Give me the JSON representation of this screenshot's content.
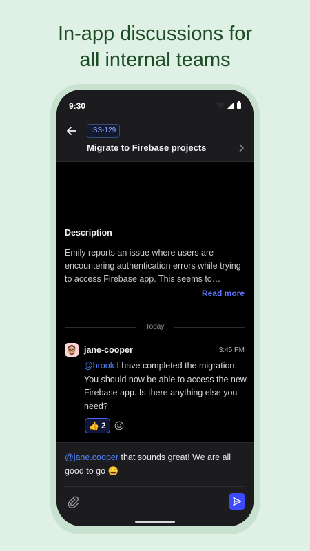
{
  "headline": {
    "line1": "In-app discussions for",
    "line2": "all internal teams"
  },
  "statusbar": {
    "time": "9:30"
  },
  "issue": {
    "tag": "ISS-129",
    "title": "Migrate to Firebase projects"
  },
  "description": {
    "heading": "Description",
    "body": "Emily reports an issue where users are encountering authentication errors while trying to access Firebase app. This seems to…",
    "read_more": "Read more"
  },
  "divider": {
    "label": "Today"
  },
  "message": {
    "username": "jane-cooper",
    "time": "3:45 PM",
    "mention": "@brook",
    "text": " I have completed the migration. You should now be able to access the new Firebase app. Is there anything else you need?",
    "reaction": {
      "emoji": "👍",
      "count": "2"
    }
  },
  "composer": {
    "mention": "@jane.cooper",
    "text": " that sounds great! We are all good to go",
    "emoji": "😄"
  },
  "colors": {
    "accent": "#3d49ff",
    "mention": "#4f86ff",
    "brand_green": "#1d4d26",
    "background": "#dff0e4"
  },
  "icons": [
    "back-arrow-icon",
    "chevron-right-icon",
    "wifi-icon",
    "signal-icon",
    "battery-icon",
    "add-reaction-icon",
    "paperclip-icon",
    "send-icon"
  ]
}
